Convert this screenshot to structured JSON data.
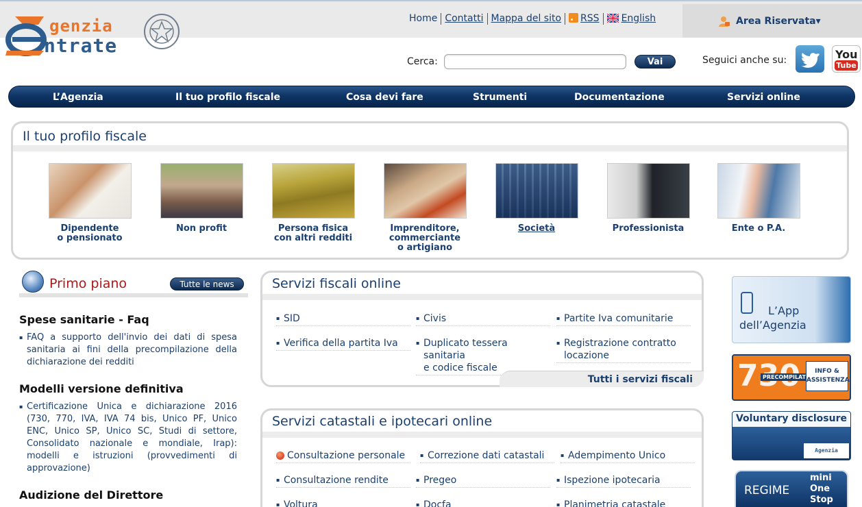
{
  "header": {
    "logo": {
      "line1": "genzia",
      "line2": "ntrate"
    },
    "toplinks": [
      {
        "label": "Home"
      },
      {
        "label": "Contatti"
      },
      {
        "label": "Mappa del sito"
      },
      {
        "label": "RSS"
      },
      {
        "label": "English"
      }
    ],
    "area_riservata": "Area Riservata▾",
    "search": {
      "label": "Cerca:",
      "value": "",
      "placeholder": "",
      "button": "Vai"
    },
    "follow_label": "Seguici anche su:",
    "youtube": {
      "you": "You",
      "tube": "Tube"
    }
  },
  "nav": {
    "items": [
      {
        "label": "L’Agenzia"
      },
      {
        "label": "Il tuo profilo fiscale"
      },
      {
        "label": "Cosa devi fare"
      },
      {
        "label": "Strumenti"
      },
      {
        "label": "Documentazione"
      },
      {
        "label": "Servizi online"
      }
    ]
  },
  "profile": {
    "title": "Il tuo profilo fiscale",
    "items": [
      {
        "label": "Dipendente\no pensionato"
      },
      {
        "label": "Non profit"
      },
      {
        "label": "Persona fisica\ncon altri redditi"
      },
      {
        "label": "Imprenditore,\ncommerciante\no artigiano"
      },
      {
        "label": "Società"
      },
      {
        "label": "Professionista"
      },
      {
        "label": "Ente o P.A."
      }
    ]
  },
  "primo_piano": {
    "title": "Primo piano",
    "button": "Tutte le news",
    "news": [
      {
        "title": "Spese sanitarie - Faq",
        "text": "FAQ a supporto dell'invio dei dati di spesa sanitaria ai fini della precompilazione della dichiarazione dei redditi"
      },
      {
        "title": "Modelli versione definitiva",
        "text": "Certificazione Unica e dichiarazione 2016 (730, 770, IVA, IVA 74 bis, Unico PF, Unico ENC, Unico SP, Unico SC, Studi di settore, Consolidato nazionale e mondiale, Irap): modelli e istruzioni (provvedimenti di approvazione)"
      },
      {
        "title": "Audizione del Direttore",
        "text": ""
      }
    ]
  },
  "servizi_fiscali": {
    "title": "Servizi fiscali online",
    "links": [
      {
        "label": "SID"
      },
      {
        "label": "Civis"
      },
      {
        "label": "Partite Iva comunitarie"
      },
      {
        "label": "Verifica della partita Iva"
      },
      {
        "label": "Duplicato tessera\nsanitaria\ne codice fiscale"
      },
      {
        "label": "Registrazione contratto\nlocazione"
      }
    ],
    "all": "Tutti i servizi fiscali"
  },
  "servizi_catastali": {
    "title": "Servizi catastali e ipotecari online",
    "links": [
      {
        "label": "Consultazione personale"
      },
      {
        "label": "Correzione dati catastali"
      },
      {
        "label": "Adempimento Unico"
      },
      {
        "label": "Consultazione rendite"
      },
      {
        "label": "Pregeo"
      },
      {
        "label": "Ispezione ipotecaria"
      },
      {
        "label": "Voltura"
      },
      {
        "label": "Docfa"
      },
      {
        "label": "Planimetria catastale"
      }
    ]
  },
  "banners": {
    "app": {
      "line1": "L’App",
      "line2": "dell’Agenzia"
    },
    "b730": {
      "num": "730",
      "pre": "PRECOMPILATO",
      "info": "INFO &\nASSISTENZA"
    },
    "vd": {
      "title": "Voluntary disclosure",
      "badge": "Agenzia Entrate"
    },
    "regime": {
      "line1": "REGIME",
      "line2": "mini\nOne\nStop"
    }
  },
  "colors": {
    "brand_blue": "#1b3f6e",
    "brand_orange": "#e8752a",
    "alert_red": "#b01818"
  }
}
